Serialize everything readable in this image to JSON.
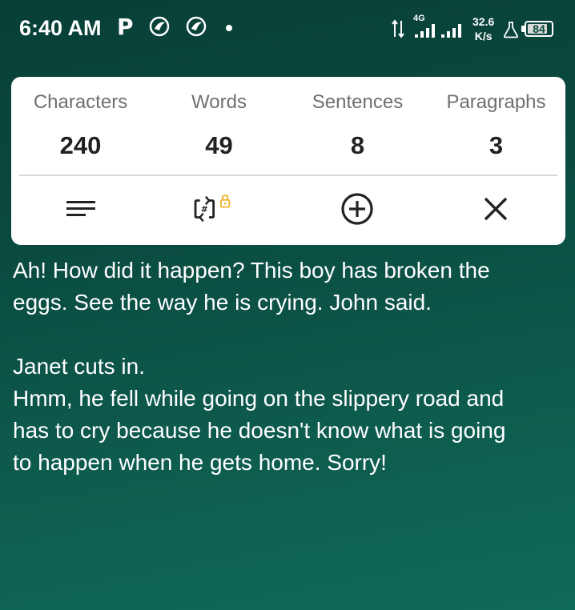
{
  "status_bar": {
    "time": "6:40 AM",
    "p_icon": "P",
    "app_icons": [
      "bird-app-icon",
      "bird-app-icon"
    ],
    "network_label": "4G",
    "speed_value": "32.6",
    "speed_unit": "K/s",
    "battery_level": "84"
  },
  "stats": [
    {
      "label": "Characters",
      "value": "240"
    },
    {
      "label": "Words",
      "value": "49"
    },
    {
      "label": "Sentences",
      "value": "8"
    },
    {
      "label": "Paragraphs",
      "value": "3"
    }
  ],
  "toolbar": {
    "icons": [
      "text-lines-icon",
      "hashtag-swap-locked-icon",
      "add-circle-icon",
      "close-icon"
    ],
    "lock_color": "#f0b323"
  },
  "text_content": {
    "lines": [
      "Ah! How did it happen? This boy has broken the",
      "eggs. See the way he is crying. John said.",
      "",
      "Janet cuts in.",
      "Hmm, he fell while going on the slippery road and",
      "has to cry because he doesn't know what is going",
      "to happen when he gets home. Sorry!"
    ]
  },
  "colors": {
    "background_top": "#083f36",
    "background_bottom": "#0f6a57",
    "card": "#ffffff"
  }
}
